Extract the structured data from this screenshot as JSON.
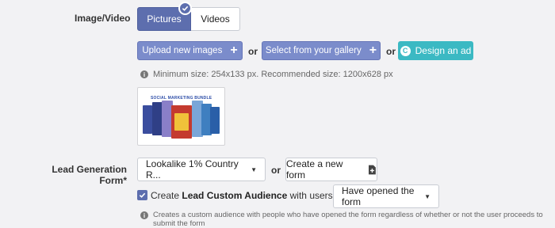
{
  "media": {
    "label": "Image/Video",
    "toggle": {
      "pictures": "Pictures",
      "videos": "Videos"
    },
    "upload_button": "Upload new images",
    "gallery_button": "Select from your gallery",
    "design_button": "Design an ad",
    "or": "or",
    "size_hint": "Minimum size: 254x133 px. Recommended size: 1200x628 px",
    "thumbnail_title": "SOCIAL MARKETING BUNDLE"
  },
  "lead_form": {
    "label": "Lead Generation Form*",
    "selected_form": "Lookalike 1% Country R...",
    "or": "or",
    "create_button": "Create a new form",
    "audience_prefix": "Create",
    "audience_bold": "Lead Custom Audience",
    "audience_suffix": "with users who",
    "audience_option": "Have opened the form",
    "audience_hint": "Creates a custom audience with people who have opened the form regardless of whether or not the user proceeds to submit the form"
  },
  "colors": {
    "primary": "#5d6eae",
    "button_blue": "#7b8ccb",
    "teal": "#3bb9c3",
    "background": "#f2f2f4"
  }
}
